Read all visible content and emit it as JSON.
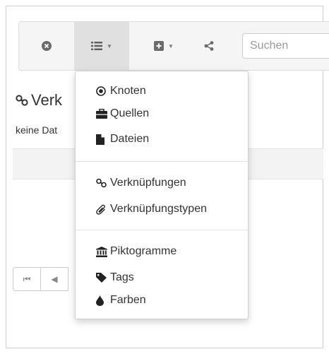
{
  "toolbar": {
    "buttons": [
      {
        "icon": "close-circle-icon"
      },
      {
        "icon": "list-icon",
        "active": true
      },
      {
        "icon": "plus-square-icon"
      },
      {
        "icon": "share-icon"
      }
    ],
    "search_placeholder": "Suchen"
  },
  "content": {
    "heading": "Verk",
    "subtext": "keine Dat"
  },
  "dropdown": {
    "groups": [
      [
        {
          "label": "Knoten",
          "icon": "radio-dot-icon"
        },
        {
          "label": "Quellen",
          "icon": "briefcase-icon"
        },
        {
          "label": "Dateien",
          "icon": "file-icon"
        }
      ],
      [
        {
          "label": "Verknüpfungen",
          "icon": "link-icon"
        },
        {
          "label": "Verknüpfungstypen",
          "icon": "paperclip-icon"
        }
      ],
      [
        {
          "label": "Piktogramme",
          "icon": "bank-icon"
        },
        {
          "label": "Tags",
          "icon": "tag-icon"
        },
        {
          "label": "Farben",
          "icon": "tint-icon"
        }
      ]
    ]
  },
  "colors": {
    "icon": "#6b6b6b",
    "active_bg": "#e0e0e0",
    "toolbar_bg": "#f5f5f5"
  }
}
